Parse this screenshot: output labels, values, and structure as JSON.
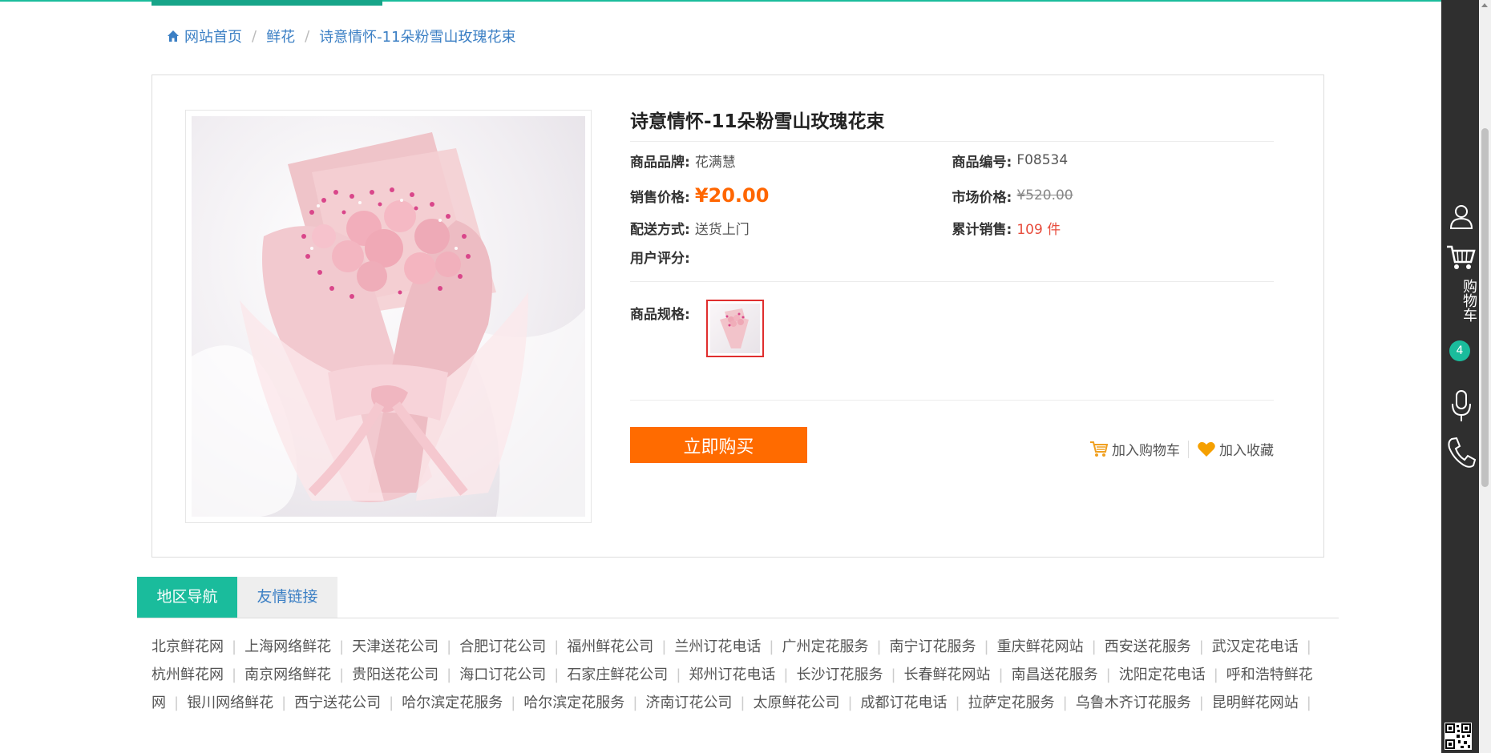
{
  "breadcrumb": {
    "home": "网站首页",
    "category": "鲜花",
    "current": "诗意情怀-11朵粉雪山玫瑰花束"
  },
  "product": {
    "title": "诗意情怀-11朵粉雪山玫瑰花束",
    "brand_label": "商品品牌:",
    "brand": "花满慧",
    "sku_label": "商品编号:",
    "sku": "F08534",
    "price_label": "销售价格:",
    "price": "¥20.00",
    "market_price_label": "市场价格:",
    "market_price": "¥520.00",
    "delivery_label": "配送方式:",
    "delivery": "送货上门",
    "sales_label": "累计销售:",
    "sales": "109 件",
    "rating_label": "用户评分:",
    "spec_label": "商品规格:",
    "buy_label": "立即购买",
    "add_cart_label": "加入购物车",
    "favorite_label": "加入收藏"
  },
  "tabs": [
    {
      "label": "地区导航"
    },
    {
      "label": "友情链接"
    }
  ],
  "links": [
    "北京鲜花网",
    "上海网络鲜花",
    "天津送花公司",
    "合肥订花公司",
    "福州鲜花公司",
    "兰州订花电话",
    "广州定花服务",
    "南宁订花服务",
    "重庆鲜花网站",
    "西安送花服务",
    "武汉定花电话",
    "杭州鲜花网",
    "南京网络鲜花",
    "贵阳送花公司",
    "海口订花公司",
    "石家庄鲜花公司",
    "郑州订花电话",
    "长沙订花服务",
    "长春鲜花网站",
    "南昌送花服务",
    "沈阳定花电话",
    "呼和浩特鲜花网",
    "银川网络鲜花",
    "西宁送花公司",
    "哈尔滨定花服务",
    "哈尔滨定花服务",
    "济南订花公司",
    "太原鲜花公司",
    "成都订花电话",
    "拉萨定花服务",
    "乌鲁木齐订花服务",
    "昆明鲜花网站"
  ],
  "sidebar": {
    "cart_label": "购物车",
    "cart_count": "4"
  },
  "colors": {
    "accent": "#1abc9c",
    "buy_button": "#ff6b00",
    "price": "#ff6600",
    "link": "#3b7fc4"
  }
}
